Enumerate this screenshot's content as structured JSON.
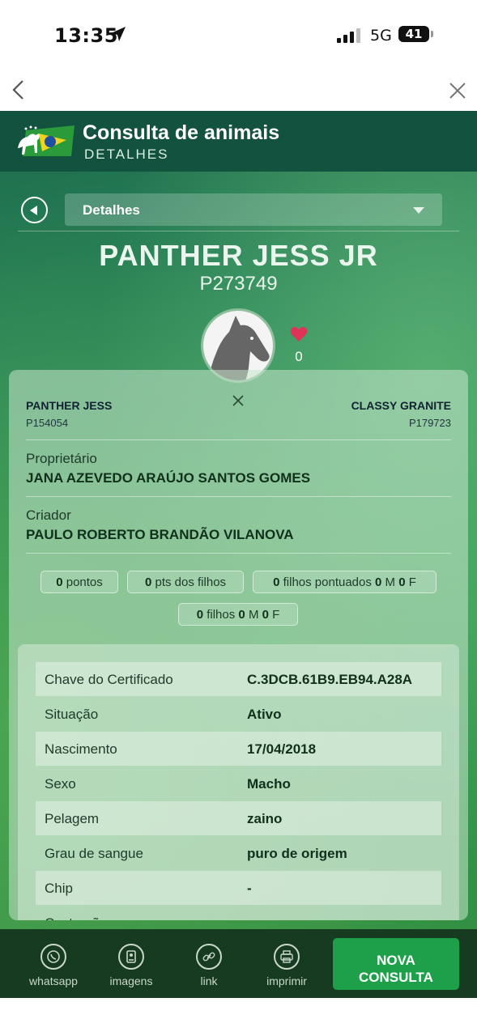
{
  "status_bar": {
    "time": "13:35",
    "network": "5G",
    "battery": "41"
  },
  "header": {
    "title": "Consulta de animais",
    "subtitle": "DETALHES"
  },
  "section_select": {
    "value": "Detalhes"
  },
  "animal": {
    "name": "PANTHER JESS JR",
    "registration": "P273749",
    "favorites": "0"
  },
  "parents": {
    "sire": {
      "name": "PANTHER JESS",
      "registration": "P154054"
    },
    "dam": {
      "name": "CLASSY GRANITE",
      "registration": "P179723"
    }
  },
  "owner": {
    "label": "Proprietário",
    "value": "JANA AZEVEDO ARAÚJO SANTOS GOMES"
  },
  "breeder": {
    "label": "Criador",
    "value": "PAULO ROBERTO BRANDÃO VILANOVA"
  },
  "stats": {
    "points": {
      "value": "0",
      "label": "pontos"
    },
    "children_points": {
      "value": "0",
      "label": "pts dos filhos"
    },
    "scored_children": {
      "value": "0",
      "label": "filhos pontuados",
      "m_value": "0",
      "m_label": "M",
      "f_value": "0",
      "f_label": "F"
    },
    "children": {
      "value": "0",
      "label": "filhos",
      "m_value": "0",
      "m_label": "M",
      "f_value": "0",
      "f_label": "F"
    }
  },
  "details_table": [
    {
      "key": "Chave do Certificado",
      "value": "C.3DCB.61B9.EB94.A28A"
    },
    {
      "key": "Situação",
      "value": "Ativo"
    },
    {
      "key": "Nascimento",
      "value": "17/04/2018"
    },
    {
      "key": "Sexo",
      "value": "Macho"
    },
    {
      "key": "Pelagem",
      "value": "zaino"
    },
    {
      "key": "Grau de sangue",
      "value": "puro de origem"
    },
    {
      "key": "Chip",
      "value": "-"
    },
    {
      "key": "Castração",
      "value": ""
    }
  ],
  "bottom_bar": {
    "whatsapp": "whatsapp",
    "images": "imagens",
    "link": "link",
    "print": "imprimir",
    "new_query_line1": "NOVA",
    "new_query_line2": "CONSULTA"
  },
  "colors": {
    "header_bg": "#12523f",
    "bottom_bar_bg": "#173b20",
    "primary_button": "#1ea04a",
    "heart": "#e0335a"
  }
}
